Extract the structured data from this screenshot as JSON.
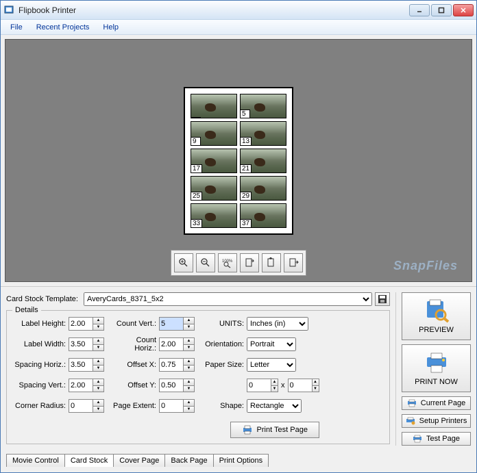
{
  "window": {
    "title": "Flipbook Printer"
  },
  "menu": {
    "file": "File",
    "recent": "Recent Projects",
    "help": "Help"
  },
  "preview": {
    "frames": [
      "",
      "5",
      "9",
      "13",
      "17",
      "21",
      "25",
      "29",
      "33",
      "37"
    ]
  },
  "watermark": "SnapFiles",
  "toolbar": {
    "zoom_in": "zoom-in",
    "zoom_out": "zoom-out",
    "zoom_100": "100%",
    "fit_page": "fit-page",
    "fit_width": "fit-width",
    "fit_height": "fit-height"
  },
  "template": {
    "label": "Card Stock Template:",
    "value": "AveryCards_8371_5x2"
  },
  "details": {
    "legend": "Details",
    "label_height": {
      "label": "Label Height:",
      "value": "2.00"
    },
    "label_width": {
      "label": "Label Width:",
      "value": "3.50"
    },
    "spacing_horiz": {
      "label": "Spacing Horiz.:",
      "value": "3.50"
    },
    "spacing_vert": {
      "label": "Spacing Vert.:",
      "value": "2.00"
    },
    "corner_radius": {
      "label": "Corner Radius:",
      "value": "0"
    },
    "count_vert": {
      "label": "Count Vert.:",
      "value": "5"
    },
    "count_horiz": {
      "label": "Count Horiz.:",
      "value": "2.00"
    },
    "offset_x": {
      "label": "Offset X:",
      "value": "0.75"
    },
    "offset_y": {
      "label": "Offset Y:",
      "value": "0.50"
    },
    "page_extent": {
      "label": "Page Extent:",
      "value": "0"
    },
    "units": {
      "label": "UNITS:",
      "value": "Inches (in)"
    },
    "orientation": {
      "label": "Orientation:",
      "value": "Portrait"
    },
    "paper_size": {
      "label": "Paper Size:",
      "value": "Letter",
      "w": "0",
      "h": "0",
      "x": "x"
    },
    "shape": {
      "label": "Shape:",
      "value": "Rectangle"
    },
    "print_test": "Print Test Page"
  },
  "actions": {
    "preview": "PREVIEW",
    "print_now": "PRINT NOW",
    "current_page": "Current Page",
    "setup_printers": "Setup Printers",
    "test_page": "Test Page"
  },
  "tabs": {
    "movie": "Movie Control",
    "card_stock": "Card Stock",
    "cover": "Cover Page",
    "back": "Back Page",
    "options": "Print Options"
  }
}
